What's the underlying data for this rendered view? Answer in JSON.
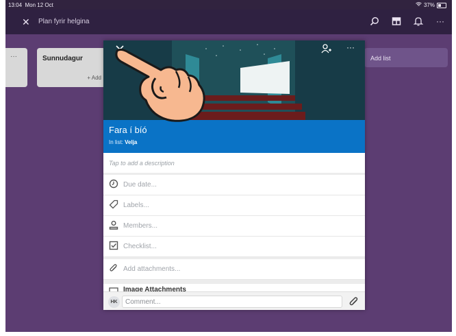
{
  "status_bar": {
    "time": "13:04",
    "date": "Mon 12 Oct",
    "battery": "37%"
  },
  "top_bar": {
    "close_icon": "close-icon",
    "board_title": "Plan fyrir helgina",
    "icons": [
      "search-icon",
      "board-view-icon",
      "bell-icon",
      "more-icon"
    ]
  },
  "board": {
    "left_list": {
      "more": "···"
    },
    "sunday_list": {
      "title": "Sunnudagur",
      "add": "+ Add"
    },
    "add_list": "Add list"
  },
  "card": {
    "cover_icons": [
      "chevron-down-icon",
      "add-member-icon",
      "more-icon"
    ],
    "title": "Fara í bíó",
    "in_list_prefix": "In list: ",
    "list_name": "Velja",
    "description_placeholder": "Tap to add a description",
    "rows": [
      {
        "label": "Due date...",
        "icon": "clock-icon"
      },
      {
        "label": "Labels...",
        "icon": "tag-icon"
      },
      {
        "label": "Members...",
        "icon": "person-icon"
      },
      {
        "label": "Checklist...",
        "icon": "checklist-icon"
      }
    ],
    "attachments": {
      "label": "Add attachments...",
      "icon": "paperclip-icon"
    },
    "image_attachments": "Image Attachments",
    "comment": {
      "avatar": "HK",
      "placeholder": "Comment..."
    }
  },
  "colors": {
    "board_bg": "#5c3d72",
    "card_header": "#0a73c6",
    "top_bar": "#2f2141"
  }
}
